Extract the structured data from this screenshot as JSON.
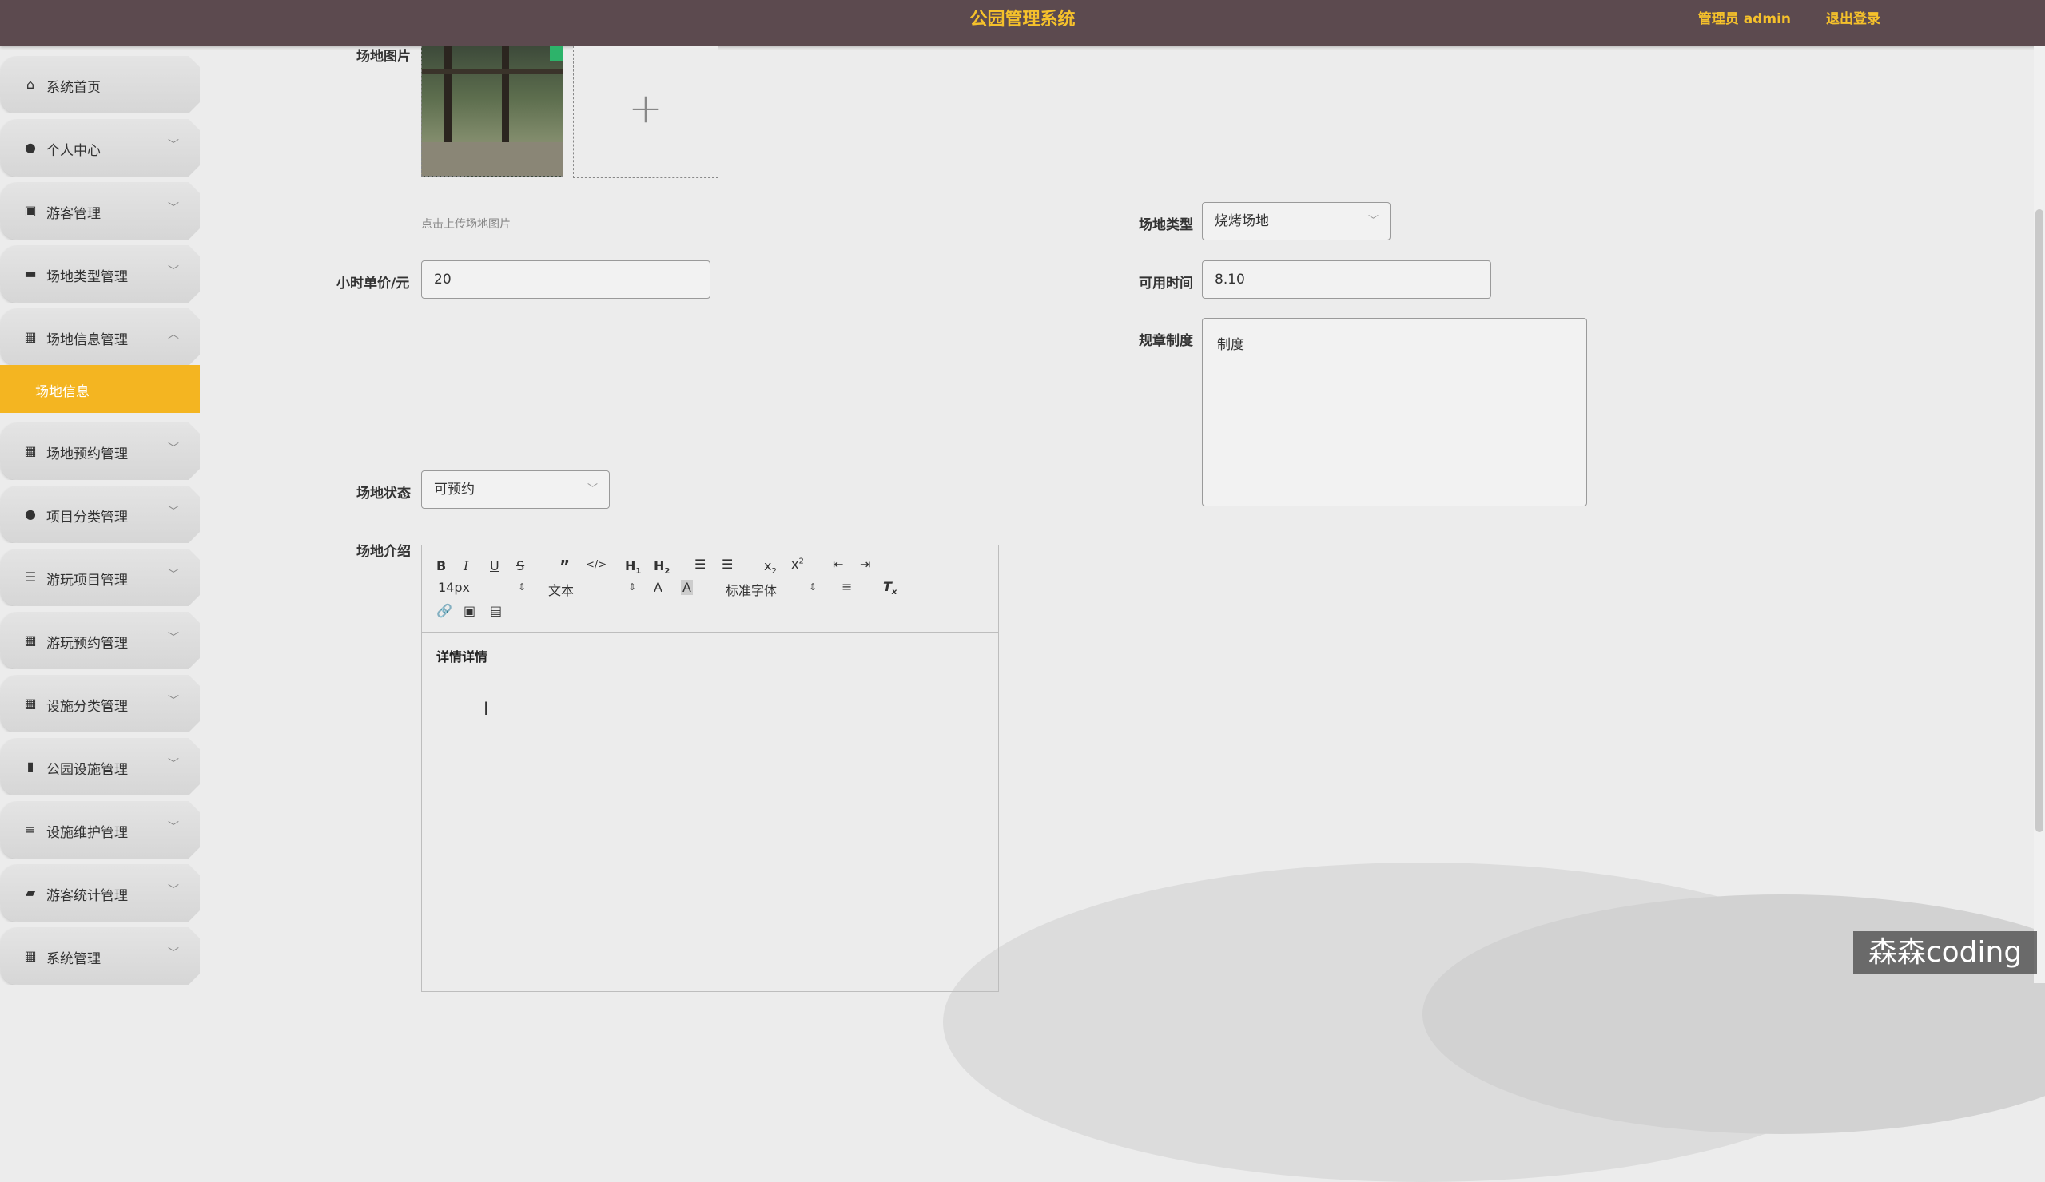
{
  "header": {
    "title": "公园管理系统",
    "admin": "管理员 admin",
    "logout": "退出登录"
  },
  "sidebar": {
    "items": [
      {
        "label": "系统首页",
        "icon": "home-icon",
        "glyph": "⌂"
      },
      {
        "label": "个人中心",
        "icon": "user-icon",
        "glyph": "●"
      },
      {
        "label": "游客管理",
        "icon": "clipboard-icon",
        "glyph": "▣"
      },
      {
        "label": "场地类型管理",
        "icon": "monitor-icon",
        "glyph": "▬"
      },
      {
        "label": "场地信息管理",
        "icon": "grid-icon",
        "glyph": "▦"
      },
      {
        "label": "场地预约管理",
        "icon": "grid-icon",
        "glyph": "▦"
      },
      {
        "label": "项目分类管理",
        "icon": "user-icon",
        "glyph": "●"
      },
      {
        "label": "游玩项目管理",
        "icon": "list-icon",
        "glyph": "☰"
      },
      {
        "label": "游玩预约管理",
        "icon": "grid-icon",
        "glyph": "▦"
      },
      {
        "label": "设施分类管理",
        "icon": "grid-icon",
        "glyph": "▦"
      },
      {
        "label": "公园设施管理",
        "icon": "bar-chart-icon",
        "glyph": "▮"
      },
      {
        "label": "设施维护管理",
        "icon": "sliders-icon",
        "glyph": "≡"
      },
      {
        "label": "游客统计管理",
        "icon": "briefcase-icon",
        "glyph": "▰"
      },
      {
        "label": "系统管理",
        "icon": "grid-icon",
        "glyph": "▦"
      }
    ],
    "active_sub": "场地信息"
  },
  "form": {
    "image_label": "场地图片",
    "upload_hint": "点击上传场地图片",
    "type_label": "场地类型",
    "type_value": "烧烤场地",
    "price_label": "小时单价/元",
    "price_value": "20",
    "time_label": "可用时间",
    "time_value": "8.10",
    "rules_label": "规章制度",
    "rules_value": "制度",
    "status_label": "场地状态",
    "status_value": "可预约",
    "intro_label": "场地介绍",
    "intro_value": "详情详情"
  },
  "editor": {
    "font_size": "14px",
    "paragraph": "文本",
    "font_family": "标准字体"
  },
  "watermark": "森森coding"
}
